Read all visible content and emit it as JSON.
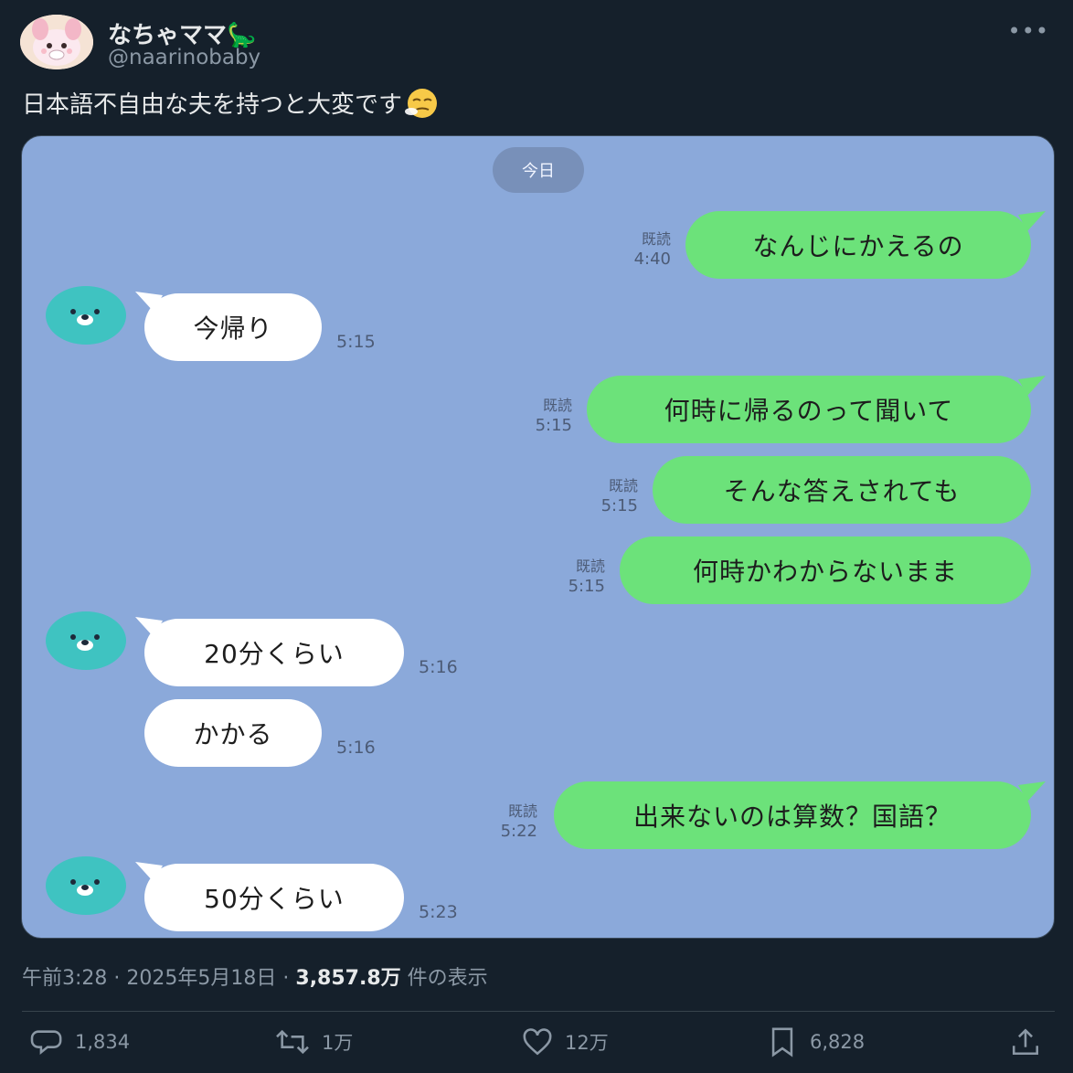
{
  "author": {
    "display_name": "なちゃママ🦕",
    "handle": "@naarinobaby"
  },
  "tweet": {
    "text": "日本語不自由な夫を持つと大変です"
  },
  "chat": {
    "date_label": "今日",
    "read_label": "既読",
    "messages": [
      {
        "side": "out",
        "text": "なんじにかえるの",
        "time": "4:40"
      },
      {
        "side": "in",
        "text": "今帰り",
        "time": "5:15"
      },
      {
        "side": "out",
        "text": "何時に帰るのって聞いて",
        "time": "5:15"
      },
      {
        "side": "out",
        "text": "そんな答えされても",
        "time": "5:15"
      },
      {
        "side": "out",
        "text": "何時かわからないまま",
        "time": "5:15"
      },
      {
        "side": "in",
        "text": "20分くらい",
        "time": "5:16"
      },
      {
        "side": "in",
        "text": "かかる",
        "time": "5:16"
      },
      {
        "side": "out",
        "text": "出来ないのは算数？国語？",
        "time": "5:22"
      },
      {
        "side": "in",
        "text": "50分くらい",
        "time": "5:23"
      }
    ]
  },
  "meta": {
    "time": "午前3:28",
    "date": "2025年5月18日",
    "views_count": "3,857.8万",
    "views_label": "件の表示"
  },
  "actions": {
    "replies": "1,834",
    "reposts": "1万",
    "likes": "12万",
    "bookmarks": "6,828"
  },
  "colors": {
    "background": "#15202b",
    "chat_background": "#8ba9da",
    "bubble_out": "#6ce27a",
    "bubble_in": "#ffffff",
    "friend_avatar": "#3fc3c1"
  },
  "icons": [
    "more-icon",
    "reply-icon",
    "repost-icon",
    "like-icon",
    "bookmark-icon",
    "share-icon",
    "friend-avatar-icon",
    "smirk-emoji-icon"
  ]
}
